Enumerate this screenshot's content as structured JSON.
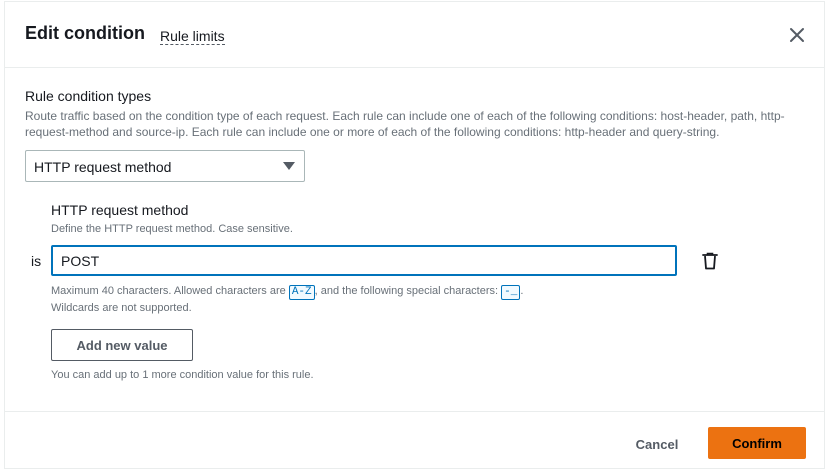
{
  "modal": {
    "title": "Edit condition",
    "rule_limits_link": "Rule limits",
    "close_icon": "close-icon"
  },
  "condition_types": {
    "label": "Rule condition types",
    "description": "Route traffic based on the condition type of each request. Each rule can include one of each of the following conditions: host-header, path, http-request-method and source-ip. Each rule can include one or more of each of the following conditions: http-header and query-string.",
    "selected": "HTTP request method"
  },
  "http_method": {
    "label": "HTTP request method",
    "description": "Define the HTTP request method. Case sensitive.",
    "operator": "is",
    "value": "POST",
    "delete_icon": "trash-icon",
    "constraint_prefix": "Maximum 40 characters. Allowed characters are ",
    "allowed_chars": "A-Z",
    "constraint_middle": ", and the following special characters: ",
    "special_chars": "-_",
    "constraint_suffix": ".",
    "wildcards_note": "Wildcards are not supported.",
    "add_button": "Add new value",
    "limit_note": "You can add up to 1 more condition value for this rule."
  },
  "footer": {
    "cancel": "Cancel",
    "confirm": "Confirm"
  },
  "colors": {
    "primary": "#ec7211",
    "focus": "#0073bb",
    "muted_text": "#687078"
  }
}
